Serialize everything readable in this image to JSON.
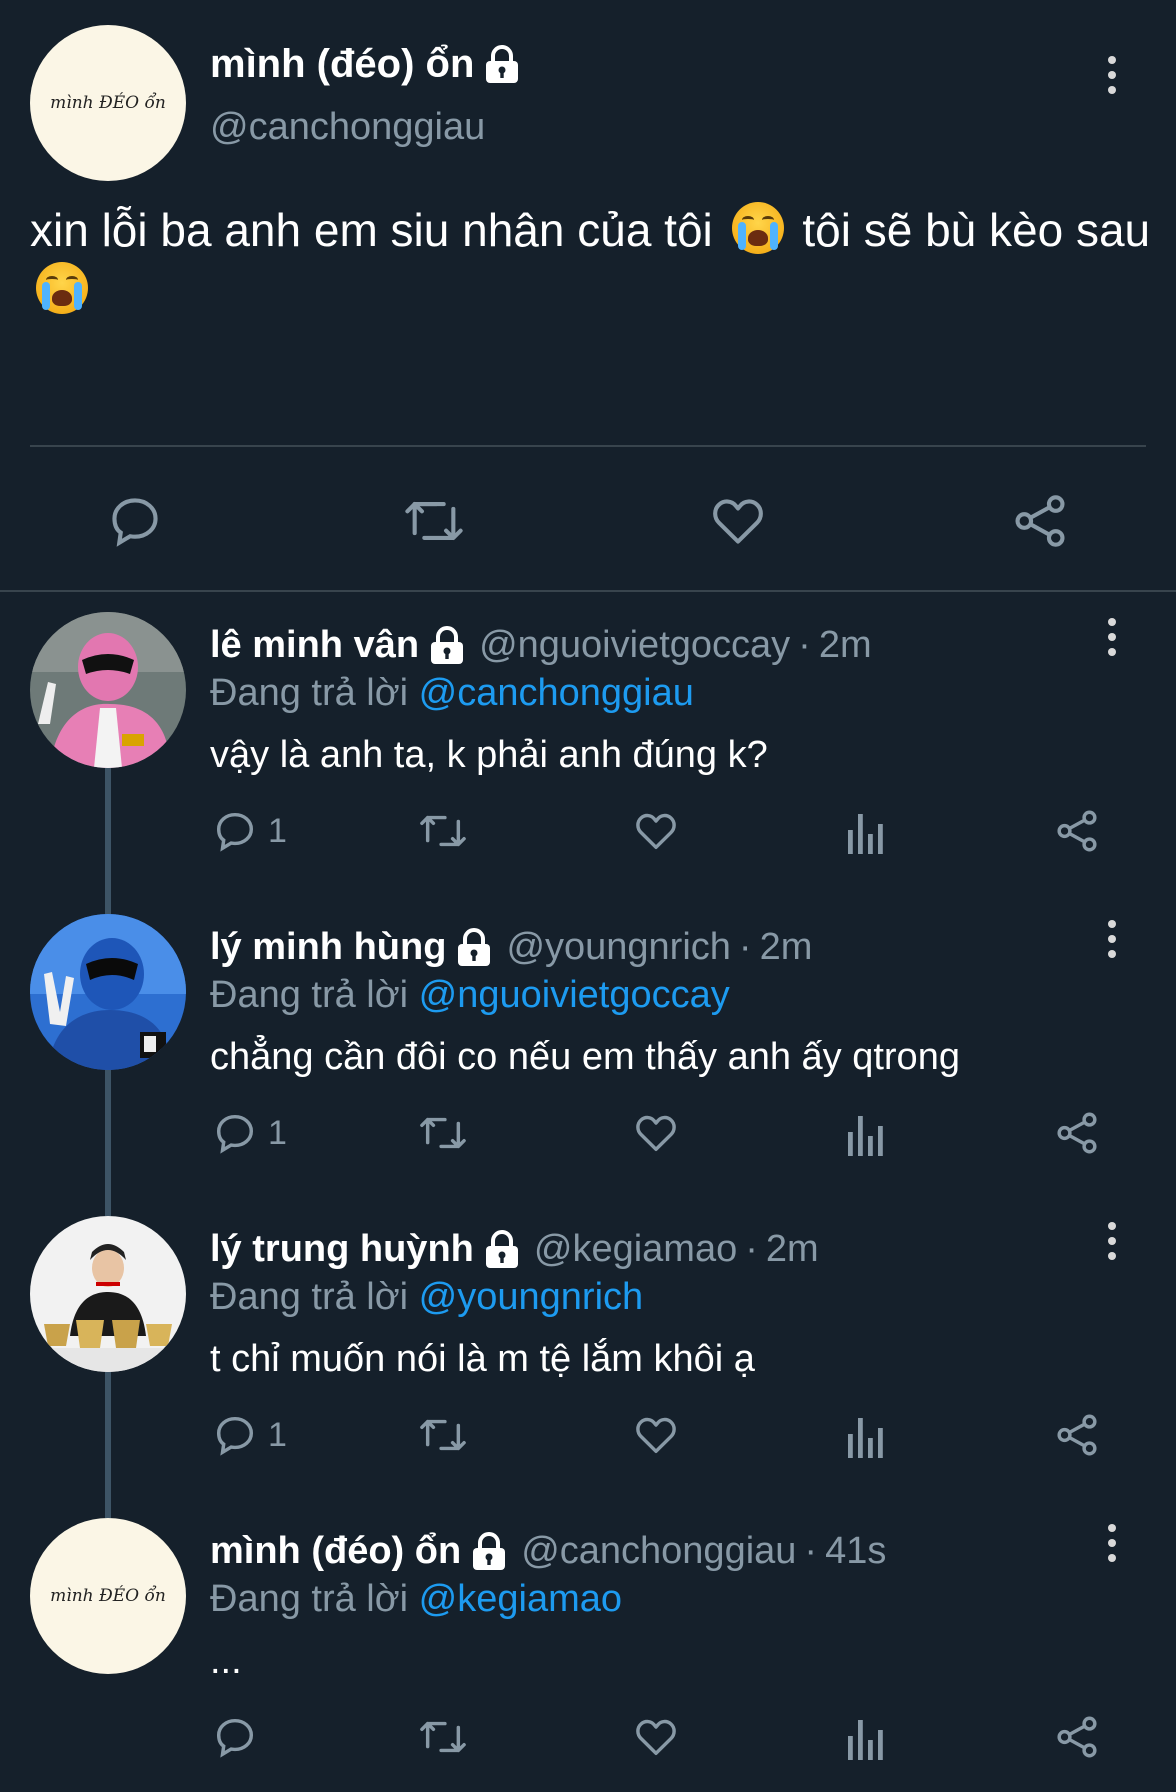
{
  "main_tweet": {
    "avatar_text": "mình ĐÉO ổn",
    "display_name": "mình (đéo) ổn",
    "handle": "@canchonggiau",
    "text_part1": "xin lỗi ba anh em siu nhân của tôi",
    "text_part2": "tôi sẽ bù kèo",
    "text_part3": "sau",
    "emoji": "loudly-crying-face"
  },
  "replies": [
    {
      "display_name": "lê minh vân",
      "handle": "@nguoivietgoccay",
      "separator": "·",
      "time": "2m",
      "replying_label": "Đang trả lời",
      "replying_to": "@canchonggiau",
      "text": "vậy là anh ta, k phải anh đúng k?",
      "reply_count": "1",
      "avatar": "pink-ranger"
    },
    {
      "display_name": "lý minh hùng",
      "handle": "@youngnrich",
      "separator": "·",
      "time": "2m",
      "replying_label": "Đang trả lời",
      "replying_to": "@nguoivietgoccay",
      "text": "chẳng cần đôi co nếu em thấy anh ấy qtrong",
      "reply_count": "1",
      "avatar": "blue-ranger"
    },
    {
      "display_name": "lý trung huỳnh",
      "handle": "@kegiamao",
      "separator": "·",
      "time": "2m",
      "replying_label": "Đang trả lời",
      "replying_to": "@youngnrich",
      "text": "t chỉ muốn nói là m tệ lắm khôi ạ",
      "reply_count": "1",
      "avatar": "man-with-trophies"
    },
    {
      "display_name": "mình (đéo) ổn",
      "handle": "@canchonggiau",
      "separator": "·",
      "time": "41s",
      "replying_label": "Đang trả lời",
      "replying_to": "@kegiamao",
      "text": "...",
      "reply_count": "",
      "avatar_text": "mình ĐÉO ổn"
    }
  ],
  "icons": {
    "reply": "reply-icon",
    "retweet": "retweet-icon",
    "like": "heart-icon",
    "share": "share-icon",
    "analytics": "analytics-icon",
    "more": "more-vertical-icon",
    "lock": "lock-icon"
  },
  "colors": {
    "background": "#15202b",
    "secondary_text": "#8899a6",
    "mention": "#1d9bf0",
    "divider": "#38444d"
  }
}
